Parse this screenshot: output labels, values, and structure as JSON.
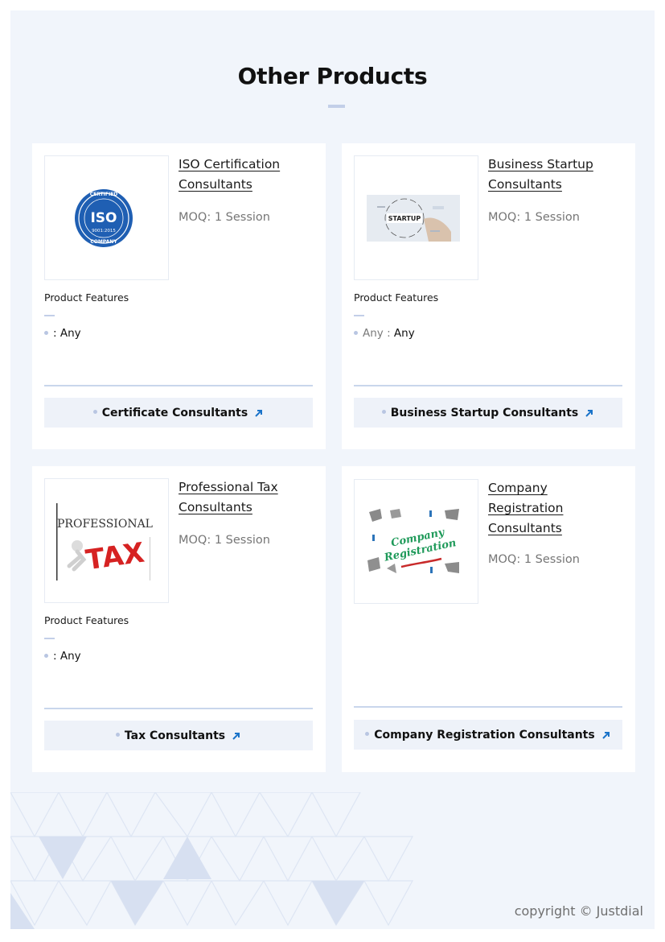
{
  "section": {
    "heading": "Other Products"
  },
  "products": [
    {
      "title": "ISO Certification Consultants",
      "moq": "MOQ: 1 Session",
      "features_label": "Product Features",
      "feature_key": "",
      "feature_value": "Any",
      "category": "Certificate Consultants",
      "image": "iso-certified-company-seal",
      "seal_text": {
        "top": "CERTIFIED",
        "main": "ISO",
        "sub": "9001:2015",
        "bottom": "COMPANY"
      }
    },
    {
      "title": "Business Startup Consultants",
      "moq": "MOQ: 1 Session",
      "features_label": "Product Features",
      "feature_key": "Any",
      "feature_value": "Any",
      "category": "Business Startup Consultants",
      "image": "startup-diagram",
      "image_text": "STARTUP"
    },
    {
      "title": "Professional Tax Consultants",
      "moq": "MOQ: 1 Session",
      "features_label": "Product Features",
      "feature_key": "",
      "feature_value": "Any",
      "category": "Tax Consultants",
      "image": "professional-tax",
      "image_text": {
        "line1": "PROFESSIONAL",
        "line2": "TAX"
      }
    },
    {
      "title": "Company Registration Consultants",
      "moq": "MOQ: 1 Session",
      "category": "Company Registration Consultants",
      "image": "company-registration",
      "image_text": {
        "line1": "Company",
        "line2": "Registration"
      }
    }
  ],
  "footer": {
    "copyright": "copyright © Justdial"
  },
  "colors": {
    "background": "#f1f5fb",
    "accent": "#c3cfe8",
    "arrow": "#1a73c9"
  }
}
